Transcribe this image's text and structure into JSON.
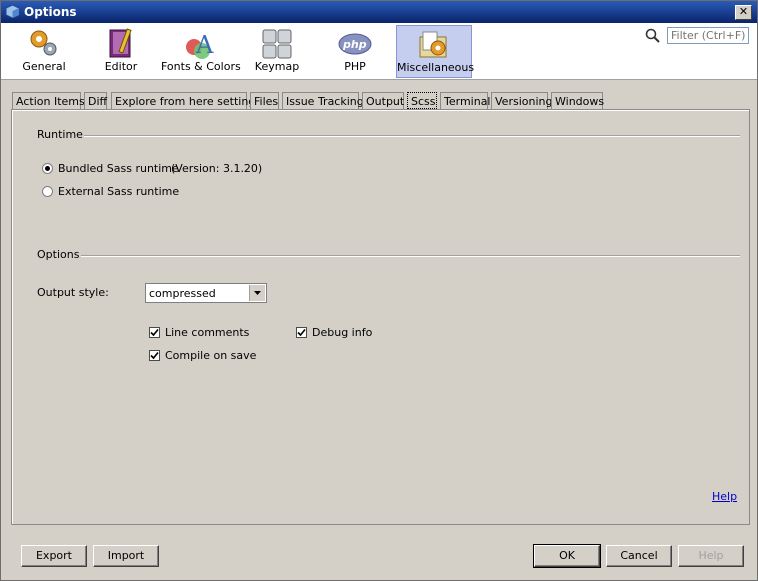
{
  "window": {
    "title": "Options"
  },
  "categories": [
    {
      "label": "General",
      "icon": "gears-icon"
    },
    {
      "label": "Editor",
      "icon": "book-pencil-icon"
    },
    {
      "label": "Fonts & Colors",
      "icon": "fonts-colors-icon"
    },
    {
      "label": "Keymap",
      "icon": "keyboard-icon"
    },
    {
      "label": "PHP",
      "icon": "php-icon"
    },
    {
      "label": "Miscellaneous",
      "icon": "folder-gear-icon",
      "active": true
    }
  ],
  "filter": {
    "placeholder": "Filter (Ctrl+F)"
  },
  "tabs": [
    "Action Items",
    "Diff",
    "Explore from here settings",
    "Files",
    "Issue Tracking",
    "Output",
    "Scss",
    "Terminal",
    "Versioning",
    "Windows"
  ],
  "active_tab": "Scss",
  "runtime": {
    "section_label": "Runtime",
    "bundled_label": "Bundled Sass runtime",
    "version_text": "(Version: 3.1.20)",
    "external_label": "External Sass runtime",
    "selected": "bundled"
  },
  "options": {
    "section_label": "Options",
    "output_style_label": "Output style:",
    "output_style_value": "compressed",
    "line_comments_label": "Line comments",
    "line_comments_checked": true,
    "debug_info_label": "Debug info",
    "debug_info_checked": true,
    "compile_on_save_label": "Compile on save",
    "compile_on_save_checked": true
  },
  "help_link": "Help",
  "buttons": {
    "export": "Export",
    "import": "Import",
    "ok": "OK",
    "cancel": "Cancel",
    "help": "Help"
  },
  "colors": {
    "titlebar": "#0a246a",
    "active_category": "#c6cef0",
    "link": "#0000cc"
  }
}
